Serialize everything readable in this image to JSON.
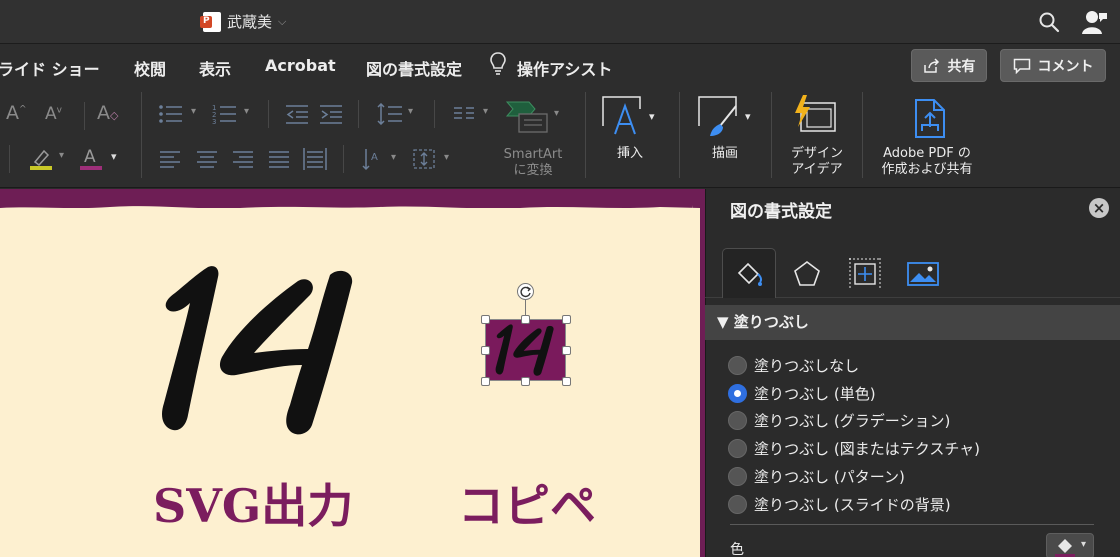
{
  "titlebar": {
    "doc_title": "武蔵美",
    "search_icon": "search-icon",
    "account_icon": "person-share-icon"
  },
  "ribbon_tabs": {
    "slideshow": "ライド ショー",
    "review": "校閲",
    "view": "表示",
    "acrobat": "Acrobat",
    "picture_format": "図の書式設定",
    "tell_me": "操作アシスト"
  },
  "buttons": {
    "share": "共有",
    "comment": "コメント"
  },
  "ribbon": {
    "smartart_line1": "SmartArt",
    "smartart_line2": "に変換",
    "insert": "挿入",
    "draw": "描画",
    "designer_line1": "デザイン",
    "designer_line2": "アイデア",
    "adobe_line1": "Adobe PDF の",
    "adobe_line2": "作成および共有"
  },
  "slide": {
    "left_caption": "SVG出力",
    "right_caption": "コピペ",
    "colors": {
      "background": "#fdf0d0",
      "accent": "#7b1d5e",
      "frame": "#6e1e55"
    }
  },
  "format_pane": {
    "title": "図の書式設定",
    "section": "塗りつぶし",
    "fill_options": [
      {
        "label": "塗りつぶしなし",
        "selected": false
      },
      {
        "label": "塗りつぶし (単色)",
        "selected": true
      },
      {
        "label": "塗りつぶし (グラデーション)",
        "selected": false
      },
      {
        "label": "塗りつぶし (図またはテクスチャ)",
        "selected": false
      },
      {
        "label": "塗りつぶし (パターン)",
        "selected": false
      },
      {
        "label": "塗りつぶし (スライドの背景)",
        "selected": false
      }
    ],
    "color_label": "色",
    "accent_color": "#2f6fe0"
  }
}
